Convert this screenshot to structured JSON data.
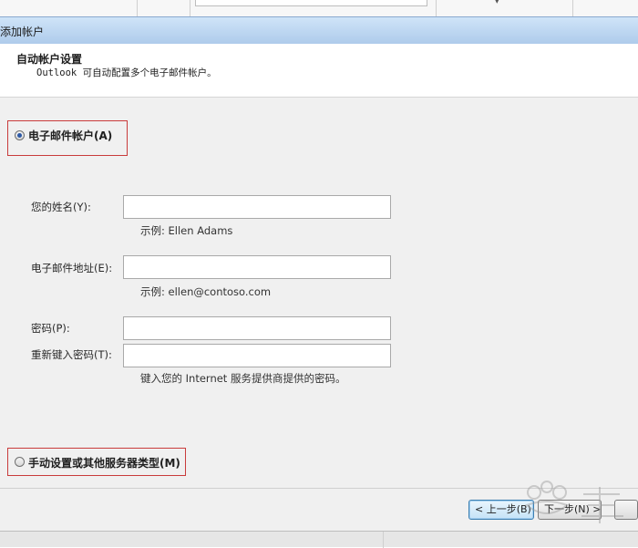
{
  "window": {
    "title": "添加帐户"
  },
  "header": {
    "title": "自动帐户设置",
    "subtitle": "Outlook 可自动配置多个电子邮件帐户。"
  },
  "options": {
    "email_account": {
      "label": "电子邮件帐户(A)",
      "selected": true
    },
    "manual": {
      "label": "手动设置或其他服务器类型(M)",
      "selected": false
    }
  },
  "form": {
    "name": {
      "label": "您的姓名(Y):",
      "value": "",
      "hint": "示例: Ellen Adams"
    },
    "email": {
      "label": "电子邮件地址(E):",
      "value": "",
      "hint": "示例: ellen@contoso.com"
    },
    "password": {
      "label": "密码(P):",
      "value": ""
    },
    "retype": {
      "label": "重新键入密码(T):",
      "value": "",
      "hint": "键入您的 Internet 服务提供商提供的密码。"
    }
  },
  "footer": {
    "back_label": "< 上一步(B)",
    "next_label": "下一步(N) >"
  },
  "colors": {
    "highlight_border": "#c93b3b",
    "titlebar": "#aecbeb",
    "radio_dot": "#2d59a6"
  }
}
